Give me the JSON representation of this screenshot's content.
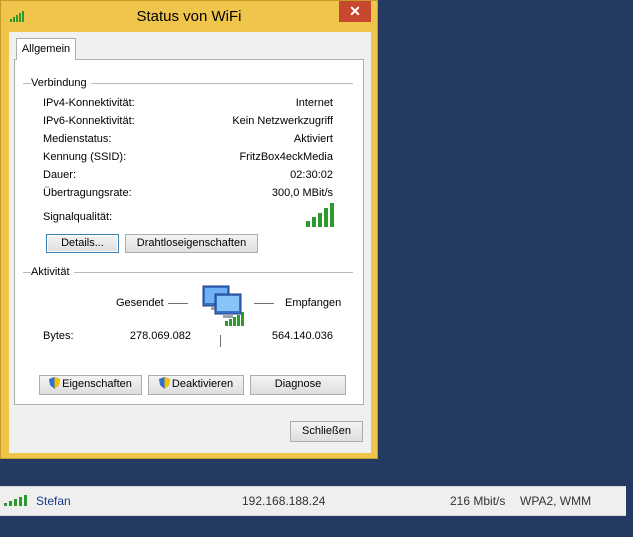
{
  "window": {
    "title": "Status von WiFi",
    "close_glyph": "✕"
  },
  "tab": {
    "label": "Allgemein"
  },
  "connection": {
    "heading": "Verbindung",
    "rows": [
      {
        "label": "IPv4-Konnektivität:",
        "value": "Internet"
      },
      {
        "label": "IPv6-Konnektivität:",
        "value": "Kein Netzwerkzugriff"
      },
      {
        "label": "Medienstatus:",
        "value": "Aktiviert"
      },
      {
        "label": "Kennung (SSID):",
        "value": "FritzBox4eckMedia"
      },
      {
        "label": "Dauer:",
        "value": "02:30:02"
      },
      {
        "label": "Übertragungsrate:",
        "value": "300,0 MBit/s"
      }
    ],
    "signal_label": "Signalqualität:",
    "signal_bars": 5,
    "details_button": "Details...",
    "wireless_button": "Drahtloseigenschaften"
  },
  "activity": {
    "heading": "Aktivität",
    "sent_label": "Gesendet",
    "received_label": "Empfangen",
    "bytes_label": "Bytes:",
    "bytes_sent": "278.069.082",
    "bytes_received": "564.140.036"
  },
  "buttons": {
    "properties": "Eigenschaften",
    "deactivate": "Deaktivieren",
    "diagnose": "Diagnose",
    "close": "Schließen"
  },
  "network_row": {
    "name": "Stefan",
    "ip": "192.168.188.24",
    "speed": "216 Mbit/s",
    "security": "WPA2, WMM"
  },
  "colors": {
    "window_frame": "#f0c54b",
    "close_red": "#c7482e",
    "desktop": "#253a63",
    "signal_green": "#2e9a2e",
    "link_blue": "#1c3c8c"
  }
}
